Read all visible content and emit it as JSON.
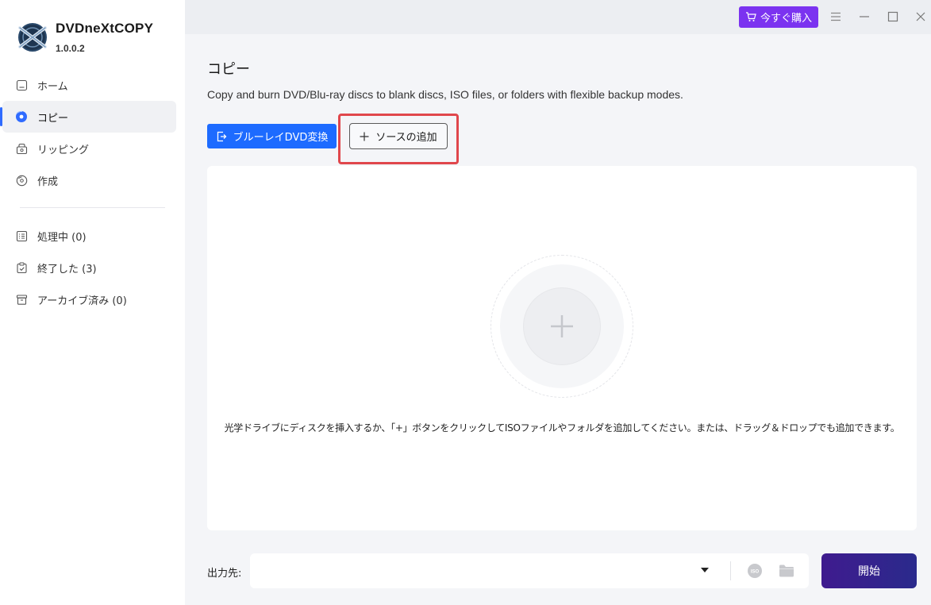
{
  "brand": {
    "name": "DVDneXtCOPY",
    "version": "1.0.0.2"
  },
  "nav": {
    "primary": [
      {
        "id": "home",
        "label": "ホーム",
        "icon": "home-icon"
      },
      {
        "id": "copy",
        "label": "コピー",
        "icon": "disc-icon",
        "active": true
      },
      {
        "id": "ripping",
        "label": "リッピング",
        "icon": "ripping-icon"
      },
      {
        "id": "create",
        "label": "作成",
        "icon": "create-disc-icon"
      }
    ],
    "secondary": [
      {
        "id": "processing",
        "label": "処理中 (0)",
        "icon": "list-icon"
      },
      {
        "id": "finished",
        "label": "終了した (3)",
        "icon": "clipboard-check-icon"
      },
      {
        "id": "archived",
        "label": "アーカイブ済み (0)",
        "icon": "archive-box-icon"
      }
    ]
  },
  "topbar": {
    "buy_label": "今すぐ購入"
  },
  "page": {
    "title": "コピー",
    "description": "Copy and burn DVD/Blu-ray discs to blank discs, ISO files, or folders with flexible backup modes.",
    "convert_button": "ブルーレイDVD変換",
    "add_source_button": "ソースの追加",
    "drop_hint": "光学ドライブにディスクを挿入するか、「+」ボタンをクリックしてISOファイルやフォルダを追加してください。または、ドラッグ＆ドロップでも追加できます。"
  },
  "output": {
    "label": "出力先:",
    "value": "",
    "iso_text": "ISO"
  },
  "start_button": "開始",
  "colors": {
    "accent_blue": "#1d6bff",
    "buy_purple": "#7b33f0",
    "highlight_red": "#e0474c",
    "start_gradient_start": "#3f1b8e",
    "start_gradient_end": "#2a2a8c"
  }
}
